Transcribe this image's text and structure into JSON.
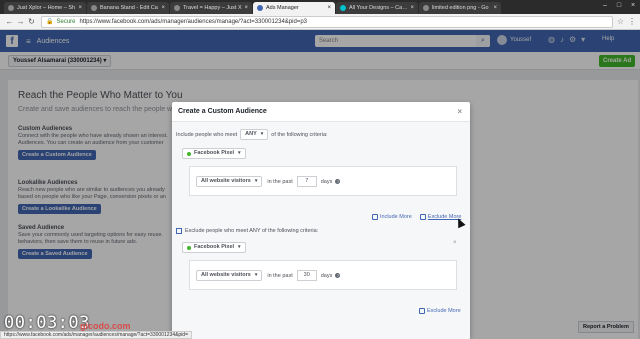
{
  "browser": {
    "tabs": [
      {
        "label": "Just Xplor – Home – Sh",
        "active": false
      },
      {
        "label": "Banana Stand - Edit Ca",
        "active": false
      },
      {
        "label": "Travel = Happy – Just X",
        "active": false
      },
      {
        "label": "Ads Manager",
        "active": true
      },
      {
        "label": "All Your Designs – Canva",
        "active": false
      },
      {
        "label": "limited edition png - Go",
        "active": false
      }
    ],
    "secure_label": "Secure",
    "url": "https://www.facebook.com/ads/manager/audiences/manage/?act=330001234&pid=p3"
  },
  "fb": {
    "section_title": "Audiences",
    "search_placeholder": "Search",
    "user_name": "Youssef",
    "help_label": "Help",
    "account_selector": "Youssef Alsamarai (330001234)",
    "create_ad_label": "Create Ad"
  },
  "page": {
    "heading": "Reach the People Who Matter to You",
    "lead": "Create and save audiences to reach the people who",
    "sections": [
      {
        "title": "Custom Audiences",
        "text": "Connect with the people who have already shown an interest. Audiences. You can create an audience from your customer",
        "button": "Create a Custom Audience"
      },
      {
        "title": "Lookalike Audiences",
        "text": "Reach new people who are similar to audiences you already based on people who like your Page, conversion pixels or an",
        "button": "Create a Lookalike Audience"
      },
      {
        "title": "Saved Audience",
        "text": "Save your commonly used targeting options for easy reuse. behaviors, then save them to reuse in future ads.",
        "button": "Create a Saved Audience"
      }
    ],
    "report_label": "Report a Problem"
  },
  "modal": {
    "title": "Create a Custom Audience",
    "include_prefix": "Include people who meet",
    "include_match": "ANY",
    "include_suffix": "of the following criteria:",
    "pixel_1": "Facebook Pixel",
    "visitors_1": "All website visitors",
    "in_the_past_1": "in the past",
    "days_value_1": "7",
    "days_label_1": "days",
    "include_more": "Include More",
    "exclude_more_1": "Exclude More",
    "exclude_text": "Exclude people who meet ANY of the following criteria:",
    "pixel_2": "Facebook Pixel",
    "visitors_2": "All website visitors",
    "in_the_past_2": "in the past",
    "days_value_2": "30",
    "days_label_2": "days",
    "exclude_more_2": "Exclude More"
  },
  "overlay": {
    "timer": "00:03:03",
    "watermark": "gicodo.com",
    "status_url": "https://www.facebook.com/ads/manager/audiences/manage/?act=330001234&pid="
  }
}
